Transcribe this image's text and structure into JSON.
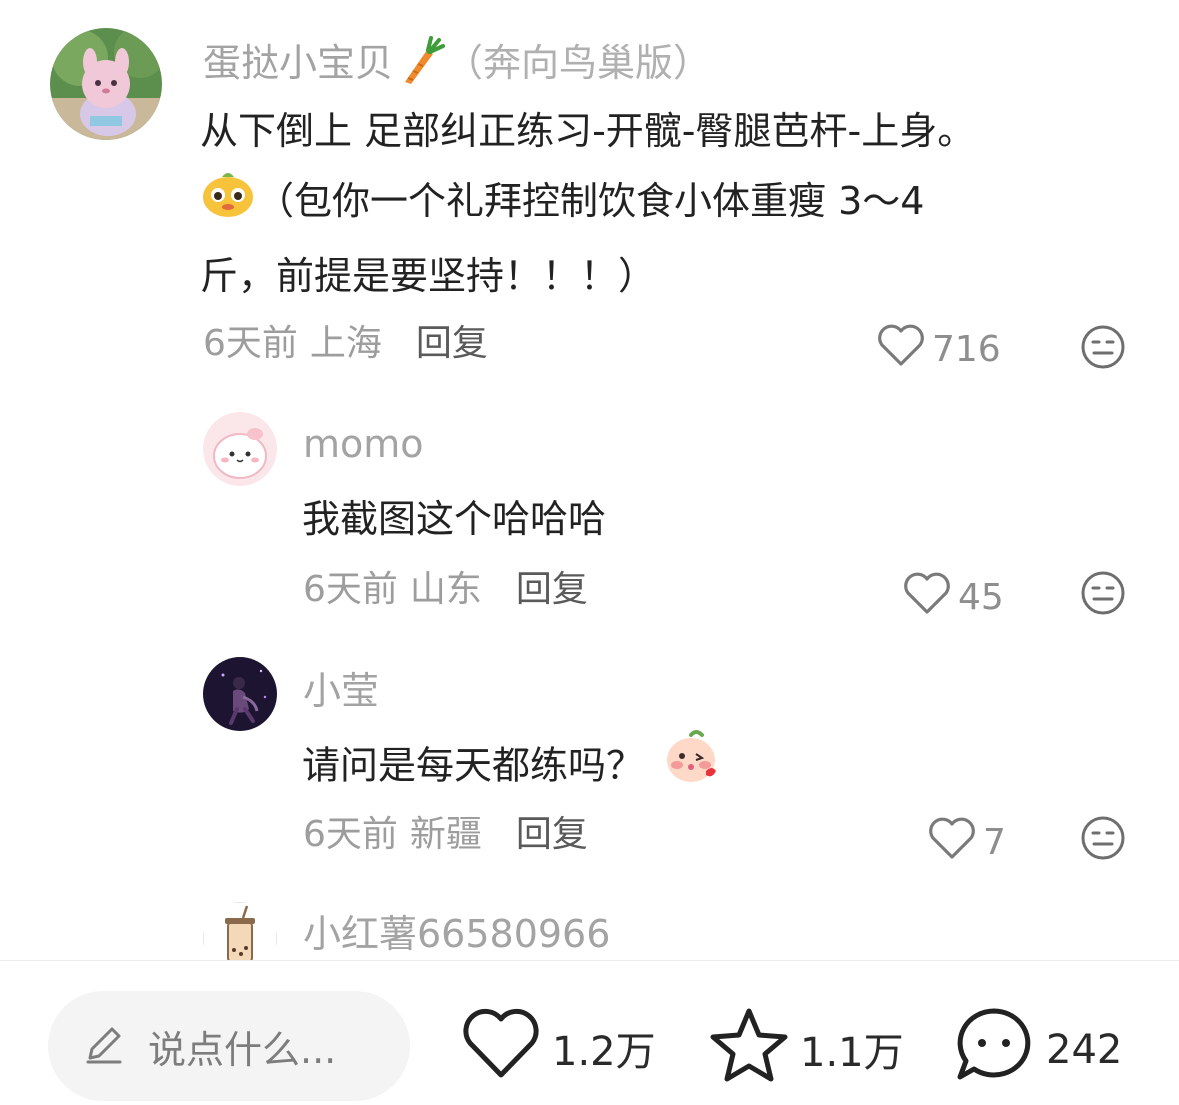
{
  "comments": {
    "main": {
      "username": "蛋挞小宝贝",
      "username_tag": "（奔向鸟巢版）",
      "badge_icon": "carrot-icon",
      "text_line1": "从下倒上 足部纠正练习-开髋-臀腿芭杆-上身。",
      "emoji_icon": "cute-mascot-emoji",
      "text_line2": "（包你一个礼拜控制饮食小体重瘦 3～4",
      "text_line3": "斤，前提是要坚持！！！）",
      "time": "6天前",
      "location": "上海",
      "reply_label": "回复",
      "likes": "716"
    },
    "replies": [
      {
        "username": "momo",
        "text": "我截图这个哈哈哈",
        "time": "6天前",
        "location": "山东",
        "reply_label": "回复",
        "likes": "45"
      },
      {
        "username": "小莹",
        "text": "请问是每天都练吗？",
        "emoji_icon": "blushing-kiss-emoji",
        "time": "6天前",
        "location": "新疆",
        "reply_label": "回复",
        "likes": "7"
      },
      {
        "username": "小红薯66580966"
      }
    ]
  },
  "bottom_bar": {
    "input_placeholder": "说点什么...",
    "like_count": "1.2万",
    "collect_count": "1.1万",
    "comment_count": "242"
  },
  "colors": {
    "text_primary": "#222222",
    "text_secondary": "#9d9d9d",
    "username": "#a3a3a3",
    "input_bg": "#f4f4f4"
  }
}
